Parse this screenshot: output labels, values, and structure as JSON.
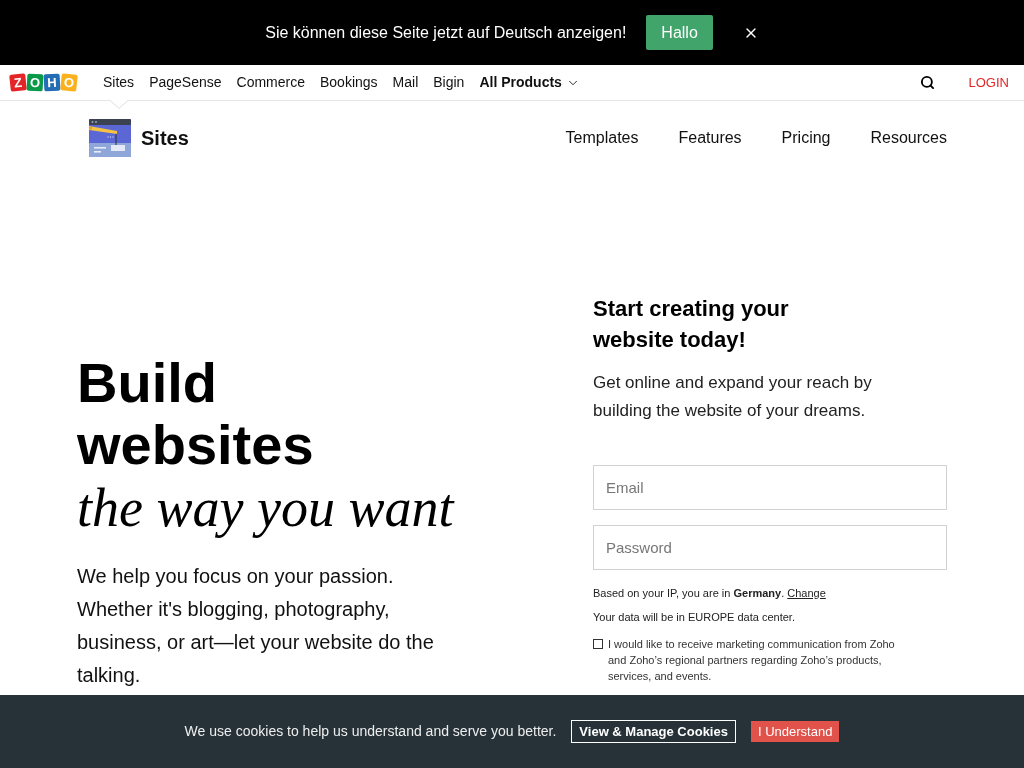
{
  "language_banner": {
    "message": "Sie können diese Seite jetzt auf Deutsch anzeigen!",
    "button": "Hallo"
  },
  "top_nav": {
    "logo": [
      {
        "char": "Z",
        "color": "#e42527"
      },
      {
        "char": "O",
        "color": "#089949"
      },
      {
        "char": "H",
        "color": "#226db4"
      },
      {
        "char": "O",
        "color": "#f9b21d"
      }
    ],
    "items": [
      {
        "label": "Sites",
        "kind": "link",
        "selected": true
      },
      {
        "label": "PageSense",
        "kind": "link",
        "selected": false
      },
      {
        "label": "Commerce",
        "kind": "link",
        "selected": false
      },
      {
        "label": "Bookings",
        "kind": "link",
        "selected": false
      },
      {
        "label": "Mail",
        "kind": "link",
        "selected": false
      },
      {
        "label": "Bigin",
        "kind": "link",
        "selected": false
      },
      {
        "label": "All Products",
        "kind": "dropdown",
        "selected": false
      }
    ],
    "login": "LOGIN"
  },
  "product_bar": {
    "name": "Sites",
    "links": [
      "Templates",
      "Features",
      "Pricing",
      "Resources"
    ]
  },
  "hero": {
    "headline": "Build websites",
    "tagline": "the way you want",
    "description": "We help you focus on your passion. Whether it's blogging, photography, business, or art—let your website do the talking."
  },
  "signup": {
    "title": "Start creating your website today!",
    "subtitle": "Get online and expand your reach by building the website of your dreams.",
    "fields": [
      {
        "placeholder": "Email"
      },
      {
        "placeholder": "Password"
      }
    ],
    "location_note": "Based on your IP, you are in **Germany**.",
    "location_link": "Change",
    "data_center_note": "Your data will be in EUROPE data center.",
    "marketing_consent": {
      "label": "I would like to receive marketing communication from Zoho and Zoho’s regional partners regarding Zoho’s products, services, and events.",
      "checked": false
    }
  },
  "cookie_banner": {
    "message": "We use cookies to help us understand and serve you better.",
    "buttons": [
      {
        "label": "View & Manage Cookies",
        "kind": "outline"
      },
      {
        "label": "I Understand",
        "kind": "filled"
      }
    ]
  }
}
